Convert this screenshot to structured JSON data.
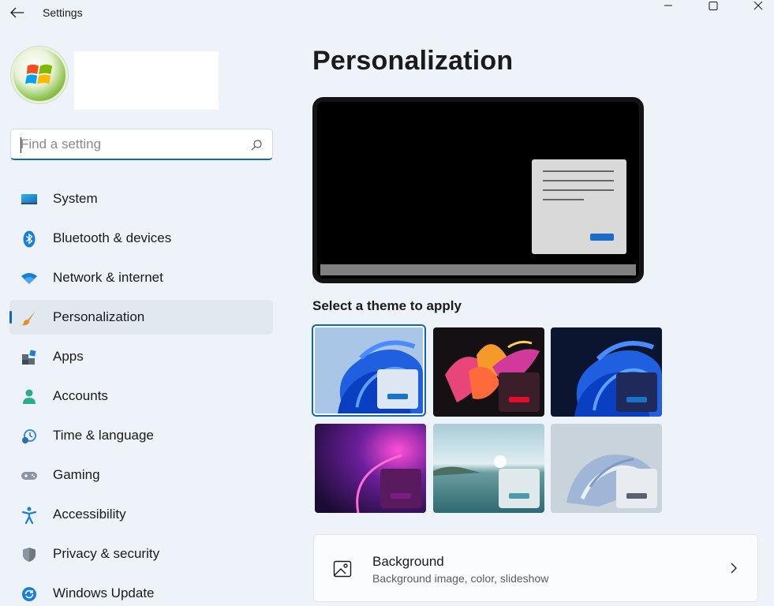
{
  "window": {
    "title": "Settings",
    "controls": {
      "minimize": "minimize-icon",
      "maximize": "maximize-icon",
      "close": "close-icon"
    }
  },
  "search": {
    "placeholder": "Find a setting",
    "value": ""
  },
  "nav": {
    "items": [
      {
        "label": "System",
        "icon": "monitor-icon"
      },
      {
        "label": "Bluetooth & devices",
        "icon": "bluetooth-icon"
      },
      {
        "label": "Network & internet",
        "icon": "wifi-icon"
      },
      {
        "label": "Personalization",
        "icon": "paintbrush-icon",
        "active": true
      },
      {
        "label": "Apps",
        "icon": "apps-icon"
      },
      {
        "label": "Accounts",
        "icon": "person-icon"
      },
      {
        "label": "Time & language",
        "icon": "clock-globe-icon"
      },
      {
        "label": "Gaming",
        "icon": "gamepad-icon"
      },
      {
        "label": "Accessibility",
        "icon": "accessibility-icon"
      },
      {
        "label": "Privacy & security",
        "icon": "shield-icon"
      },
      {
        "label": "Windows Update",
        "icon": "refresh-icon"
      }
    ]
  },
  "main": {
    "title": "Personalization",
    "theme_heading": "Select a theme to apply",
    "themes": [
      {
        "name": "windows-light",
        "selected": true,
        "chip_color": "#dde6f3",
        "bar_color": "#1a73c9"
      },
      {
        "name": "glow",
        "selected": false,
        "chip_color": "#3a1f2a",
        "bar_color": "#e0102a"
      },
      {
        "name": "windows-dark",
        "selected": false,
        "chip_color": "#1f2a5a",
        "bar_color": "#1a73c9"
      },
      {
        "name": "captured-motion",
        "selected": false,
        "chip_color": "#5a1a5e",
        "bar_color": "#7a1e86"
      },
      {
        "name": "sunrise",
        "selected": false,
        "chip_color": "#dfe9ec",
        "bar_color": "#4a9cab"
      },
      {
        "name": "flow",
        "selected": false,
        "chip_color": "#e8ecf0",
        "bar_color": "#56636f"
      }
    ],
    "background_card": {
      "title": "Background",
      "subtitle": "Background image, color, slideshow",
      "icon": "image-icon"
    }
  },
  "colors": {
    "accent": "#1067b8",
    "page_bg": "#eef3f9"
  }
}
